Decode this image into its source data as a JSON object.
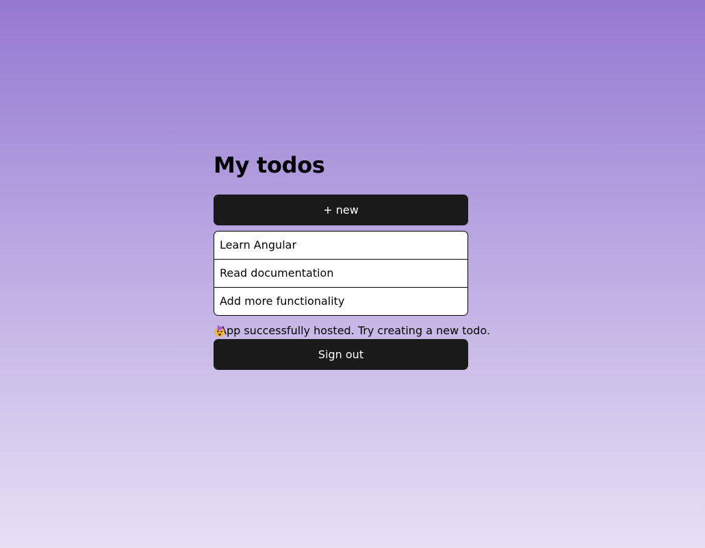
{
  "page": {
    "title": "My todos"
  },
  "actions": {
    "new_label": "+ new",
    "sign_out_label": "Sign out"
  },
  "todos": [
    {
      "content": "Learn Angular"
    },
    {
      "content": "Read documentation"
    },
    {
      "content": "Add more functionality"
    }
  ],
  "status": {
    "icon": "party-face-icon",
    "message": "App successfully hosted. Try creating a new todo."
  },
  "colors": {
    "button_bg": "#1a1a1a",
    "background_top": "#9579d1",
    "background_bottom": "#e7e0f4"
  }
}
